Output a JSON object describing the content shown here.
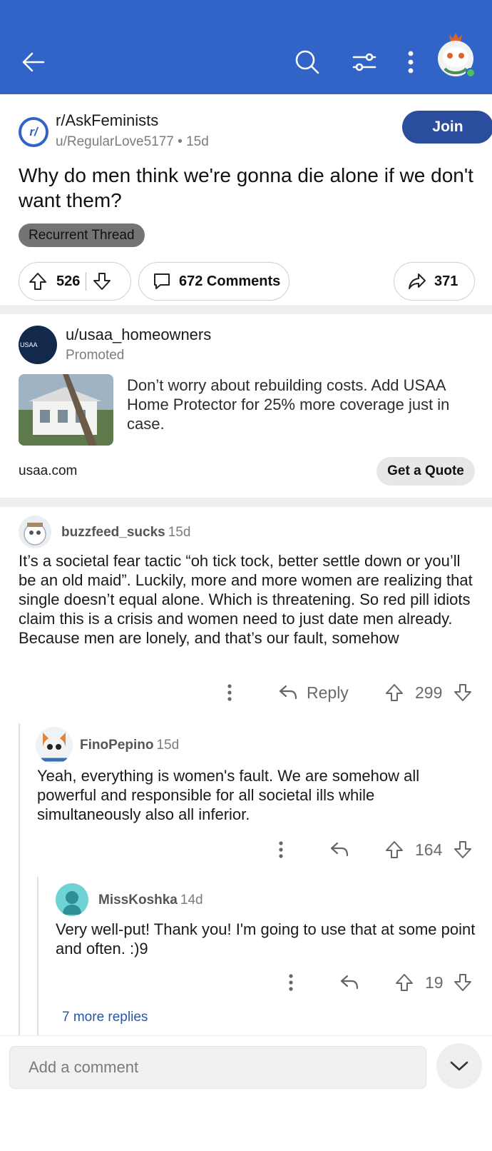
{
  "header": {
    "back_icon": "arrow-left-icon",
    "search_icon": "search-icon",
    "filter_icon": "sliders-icon",
    "more_icon": "kebab-menu-icon",
    "avatar_icon": "user-avatar-icon",
    "bar_color": "#3263c7"
  },
  "post": {
    "subreddit": "r/AskFeminists",
    "subreddit_icon_text": "r/",
    "author": "u/RegularLove5177",
    "age": "• 15d",
    "join_label": "Join",
    "title": "Why do men think we're gonna die alone if we don't want them?",
    "flair": "Recurrent Thread",
    "upvotes": "526",
    "comments": "672 Comments",
    "shares": "371"
  },
  "ad": {
    "user": "u/usaa_homeowners",
    "avatar_text": "USAA",
    "promoted": "Promoted",
    "text": "Don’t worry about rebuilding costs. Add USAA Home Protector for 25% more coverage just in case.",
    "domain": "usaa.com",
    "cta": "Get a Quote"
  },
  "comments": [
    {
      "user": "buzzfeed_sucks",
      "age": "15d",
      "body": "It’s a societal fear tactic “oh tick tock, better settle down or you’ll be an old maid”. Luckily, more and more women are realizing that single doesn’t equal alone. Which is threatening. So red pill idiots claim this is a crisis and women need to just date men already. Because men are lonely, and that’s our fault, somehow",
      "reply_label": "Reply",
      "votes": "299"
    },
    {
      "user": "FinoPepino",
      "age": "15d",
      "body": "Yeah, everything is women's fault. We are somehow all powerful and responsible for all societal ills while simultaneously also all inferior.",
      "votes": "164"
    },
    {
      "user": "MissKoshka",
      "age": "14d",
      "body": "Very well-put! Thank you! I'm going to use that at some point and often. :)9",
      "votes": "19"
    }
  ],
  "more_replies": "7 more replies",
  "footer": {
    "placeholder": "Add a comment"
  }
}
